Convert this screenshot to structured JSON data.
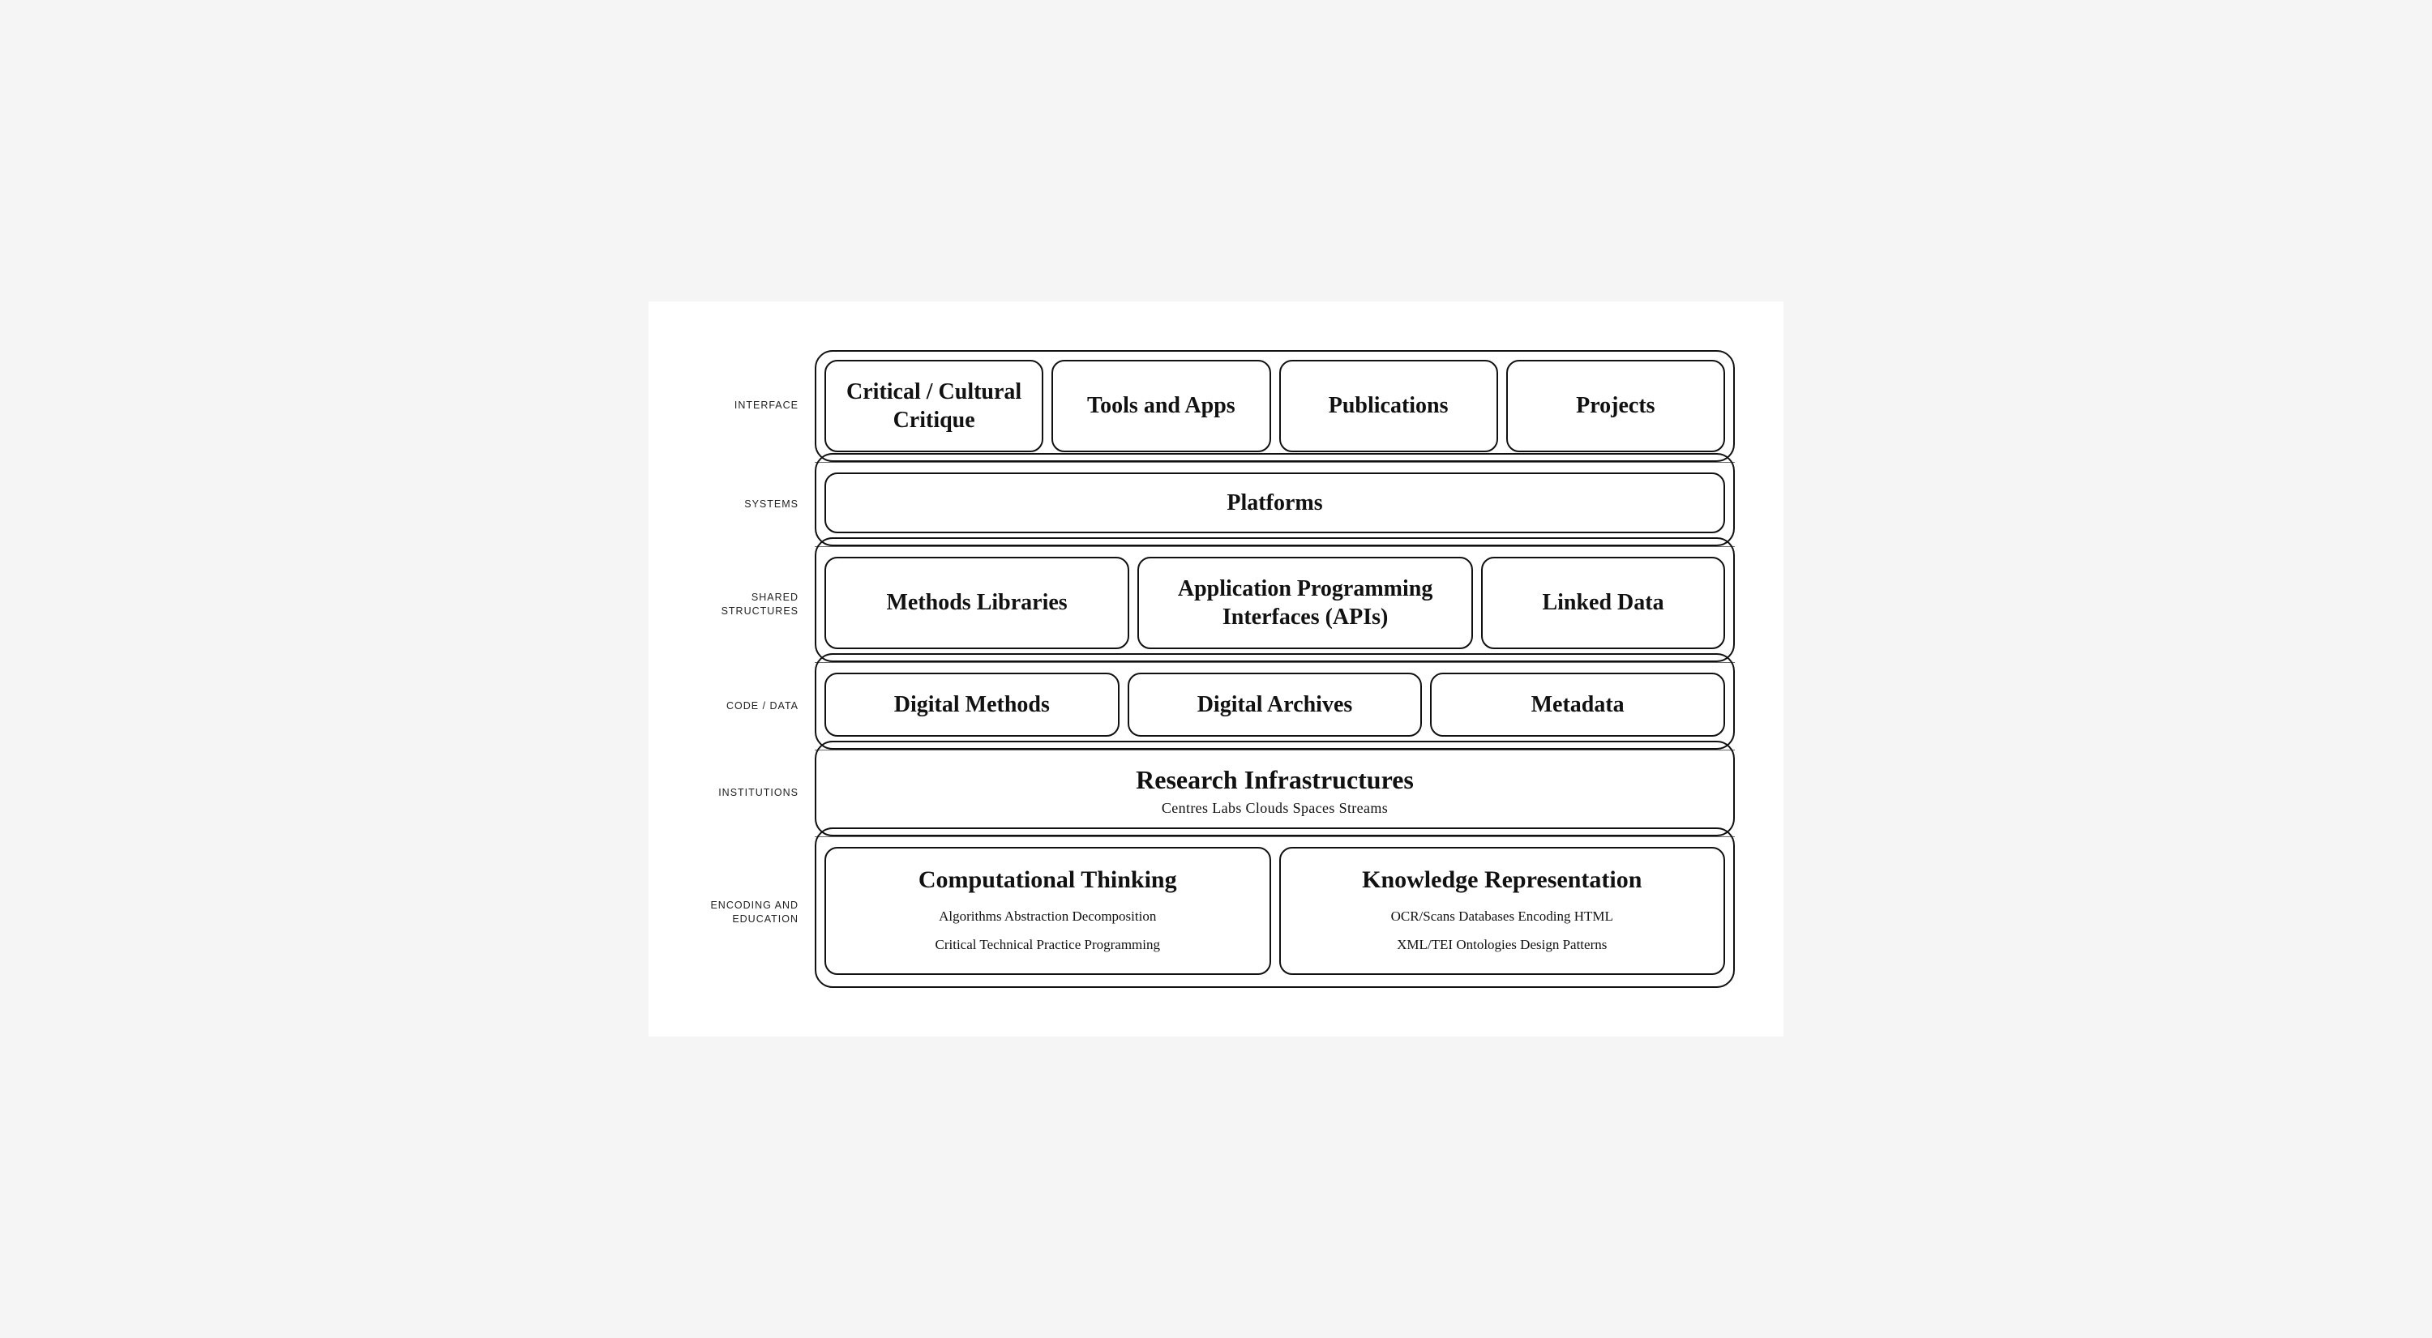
{
  "labels": {
    "interface": "INTERFACE",
    "systems": "SYSTEMS",
    "sharedStructures": "SHARED\nSTRUCTURES",
    "codeData": "CODE / DATA",
    "institutions": "INSTITUTIONS",
    "encoding": "ENCODING and\nEDUCATION"
  },
  "interface": {
    "boxes": [
      {
        "id": "critical-cultural",
        "text": "Critical /\nCultural Critique"
      },
      {
        "id": "tools-apps",
        "text": "Tools and Apps"
      },
      {
        "id": "publications",
        "text": "Publications"
      },
      {
        "id": "projects",
        "text": "Projects"
      }
    ]
  },
  "systems": {
    "text": "Platforms"
  },
  "sharedStructures": {
    "boxes": [
      {
        "id": "methods-libraries",
        "text": "Methods Libraries"
      },
      {
        "id": "apis",
        "text": "Application Programming\nInterfaces (APIs)"
      },
      {
        "id": "linked-data",
        "text": "Linked Data"
      }
    ]
  },
  "codeData": {
    "boxes": [
      {
        "id": "digital-methods",
        "text": "Digital Methods"
      },
      {
        "id": "digital-archives",
        "text": "Digital Archives"
      },
      {
        "id": "metadata",
        "text": "Metadata"
      }
    ]
  },
  "institutions": {
    "title": "Research Infrastructures",
    "subtitle": "Centres  Labs  Clouds  Spaces  Streams"
  },
  "encoding": {
    "left": {
      "title": "Computational Thinking",
      "line1": "Algorithms  Abstraction  Decomposition",
      "line2": "Critical Technical Practice  Programming"
    },
    "right": {
      "title": "Knowledge Representation",
      "line1": "OCR/Scans  Databases  Encoding  HTML",
      "line2": "XML/TEI  Ontologies  Design Patterns"
    }
  }
}
